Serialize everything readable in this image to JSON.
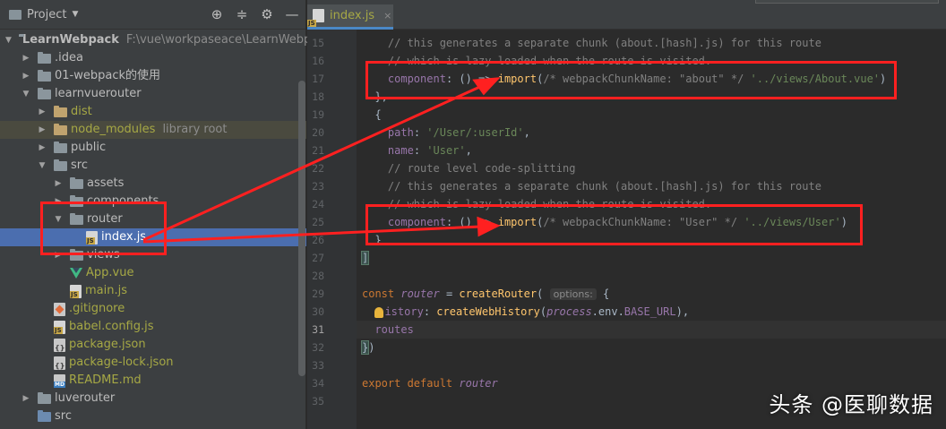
{
  "project_panel": {
    "title": "Project",
    "tree": [
      {
        "label": "LearnWebpack",
        "extra": "F:\\vue\\workpaseace\\LearnWebpack",
        "depth": 0,
        "arrow": "▼",
        "icon": "folder",
        "bold": true
      },
      {
        "label": ".idea",
        "depth": 1,
        "arrow": "▶",
        "icon": "folder"
      },
      {
        "label": "01-webpack的使用",
        "depth": 1,
        "arrow": "▶",
        "icon": "folder"
      },
      {
        "label": "learnvuerouter",
        "depth": 1,
        "arrow": "▼",
        "icon": "folder"
      },
      {
        "label": "dist",
        "depth": 2,
        "arrow": "▶",
        "icon": "folder-orange",
        "olive": true
      },
      {
        "label": "node_modules",
        "extra": "library root",
        "depth": 2,
        "arrow": "▶",
        "icon": "folder-orange",
        "olive": true,
        "highlight": true
      },
      {
        "label": "public",
        "depth": 2,
        "arrow": "▶",
        "icon": "folder"
      },
      {
        "label": "src",
        "depth": 2,
        "arrow": "▼",
        "icon": "folder"
      },
      {
        "label": "assets",
        "depth": 3,
        "arrow": "▶",
        "icon": "folder"
      },
      {
        "label": "components",
        "depth": 3,
        "arrow": "▶",
        "icon": "folder"
      },
      {
        "label": "router",
        "depth": 3,
        "arrow": "▼",
        "icon": "folder"
      },
      {
        "label": "index.js",
        "depth": 4,
        "arrow": "",
        "icon": "js",
        "selected": true
      },
      {
        "label": "views",
        "depth": 3,
        "arrow": "▶",
        "icon": "folder"
      },
      {
        "label": "App.vue",
        "depth": 3,
        "arrow": "",
        "icon": "vue",
        "olive": true
      },
      {
        "label": "main.js",
        "depth": 3,
        "arrow": "",
        "icon": "js",
        "olive": true
      },
      {
        "label": ".gitignore",
        "depth": 2,
        "arrow": "",
        "icon": "git",
        "olive": true
      },
      {
        "label": "babel.config.js",
        "depth": 2,
        "arrow": "",
        "icon": "js",
        "olive": true
      },
      {
        "label": "package.json",
        "depth": 2,
        "arrow": "",
        "icon": "json",
        "olive": true
      },
      {
        "label": "package-lock.json",
        "depth": 2,
        "arrow": "",
        "icon": "json",
        "olive": true
      },
      {
        "label": "README.md",
        "depth": 2,
        "arrow": "",
        "icon": "md",
        "olive": true
      },
      {
        "label": "luverouter",
        "depth": 1,
        "arrow": "▶",
        "icon": "folder"
      },
      {
        "label": "src",
        "depth": 1,
        "arrow": "",
        "icon": "folder-blue"
      }
    ]
  },
  "editor": {
    "tab": {
      "label": "index.js",
      "close": "×"
    },
    "current_line": 31,
    "lines": [
      {
        "n": "15",
        "html": "<span class=\"cm\">    // this generates a separate chunk (about.[hash].js) for this route</span>"
      },
      {
        "n": "16",
        "html": "<span class=\"cm\">    // which is lazy-loaded when the route is visited.</span>"
      },
      {
        "n": "17",
        "html": "    <span class=\"prop\">component</span>: () => <span class=\"fn\">import</span>(<span class=\"cm\">/* webpackChunkName: \"about\" */</span> <span class=\"str\">'../views/About.vue'</span>)"
      },
      {
        "n": "18",
        "html": "  },"
      },
      {
        "n": "19",
        "html": "  {"
      },
      {
        "n": "20",
        "html": "    <span class=\"prop\">path</span>: <span class=\"str\">'/User/:userId'</span>,"
      },
      {
        "n": "21",
        "html": "    <span class=\"prop\">name</span>: <span class=\"str\">'User'</span>,"
      },
      {
        "n": "22",
        "html": "<span class=\"cm\">    // route level code-splitting</span>"
      },
      {
        "n": "23",
        "html": "<span class=\"cm\">    // this generates a separate chunk (about.[hash].js) for this route</span>"
      },
      {
        "n": "24",
        "html": "<span class=\"cm\">    // which is lazy-loaded when the route is visited.</span>"
      },
      {
        "n": "25",
        "html": "    <span class=\"prop\">component</span>: () => <span class=\"fn\">import</span>(<span class=\"cm\">/* webpackChunkName: \"User\" */</span> <span class=\"str\">'../views/User'</span>)"
      },
      {
        "n": "26",
        "html": "  }"
      },
      {
        "n": "27",
        "html": "<span class=\"bracket-hl\">]</span>"
      },
      {
        "n": "28",
        "html": ""
      },
      {
        "n": "29",
        "html": "<span class=\"kw\">const</span> <span class=\"var\">router</span> = <span class=\"fn\">createRouter</span>( <span class=\"hint\">options:</span> {"
      },
      {
        "n": "30",
        "html": "  <span class=\"bulb\"></span><span class=\"prop\">istory</span>: <span class=\"fn\">createWebHistory</span>(<span class=\"var\">process</span>.env.<span class=\"prop\">BASE_URL</span>),"
      },
      {
        "n": "31",
        "html": "  <span class=\"prop\">routes</span>"
      },
      {
        "n": "32",
        "html": "<span class=\"bracket-hl\">}</span>)"
      },
      {
        "n": "33",
        "html": ""
      },
      {
        "n": "34",
        "html": "<span class=\"kw\">export default</span> <span class=\"var\">router</span>"
      },
      {
        "n": "35",
        "html": ""
      }
    ]
  },
  "watermark": "头条 @医聊数据",
  "colors": {
    "annotation_red": "#ff2020",
    "selection_blue": "#4b6eaf"
  }
}
